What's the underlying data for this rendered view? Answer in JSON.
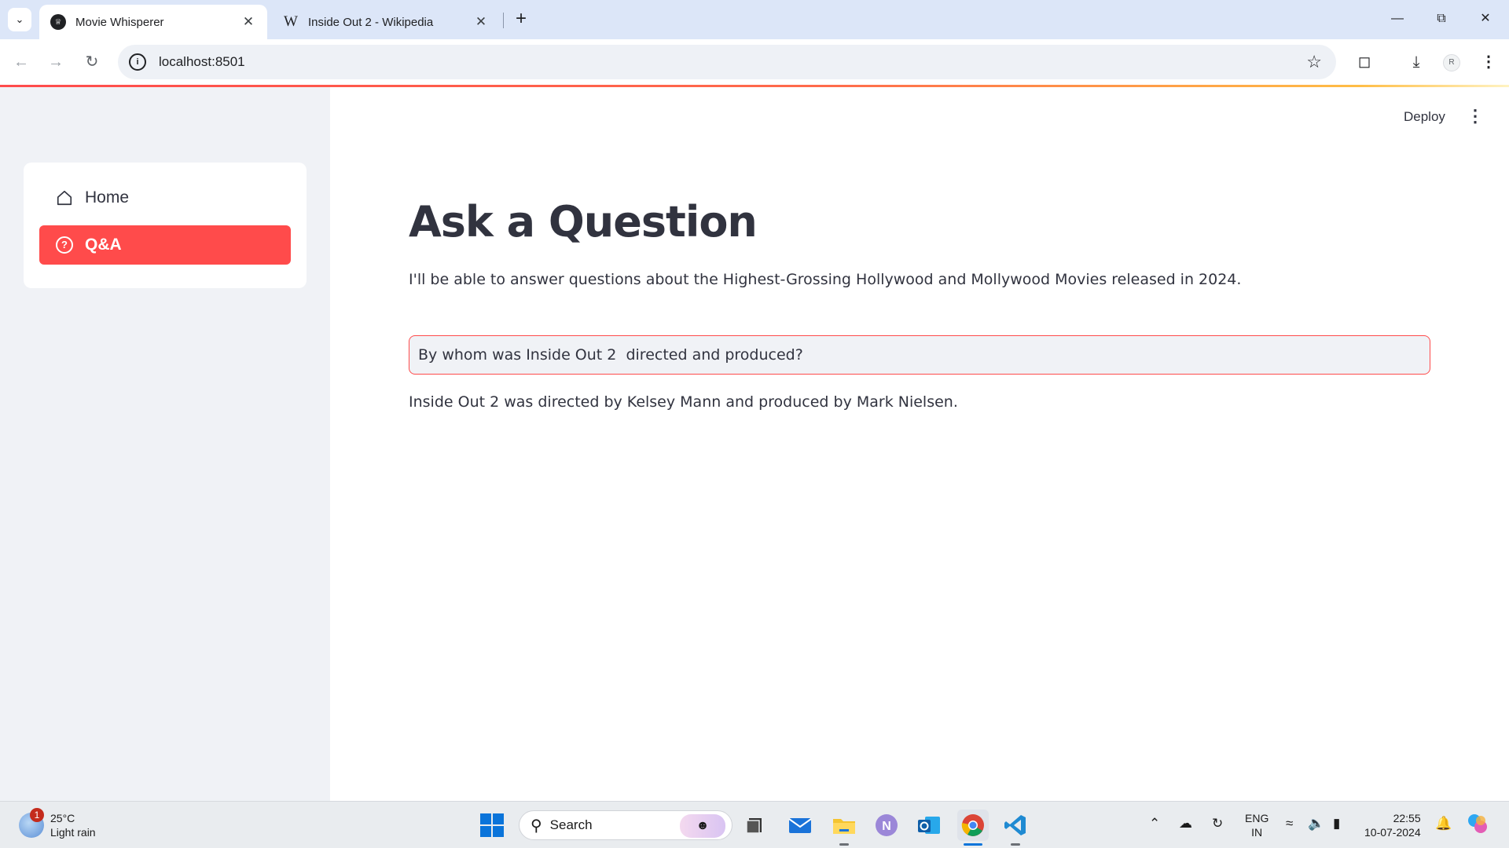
{
  "browser": {
    "tabs": [
      {
        "title": "Movie Whisperer",
        "active": true,
        "favicon": "crown-icon"
      },
      {
        "title": "Inside Out 2 - Wikipedia",
        "active": false,
        "favicon": "wikipedia-w-icon"
      }
    ],
    "url": "localhost:8501"
  },
  "app": {
    "header": {
      "deploy_label": "Deploy"
    },
    "sidebar": {
      "items": [
        {
          "label": "Home",
          "icon": "house-icon",
          "active": false
        },
        {
          "label": "Q&A",
          "icon": "question-circle-icon",
          "active": true
        }
      ]
    },
    "main": {
      "title": "Ask a Question",
      "intro": "I'll be able to answer questions about the Highest-Grossing Hollywood and Mollywood Movies released in 2024.",
      "question_value": "By whom was Inside Out 2  directed and produced?",
      "answer": "Inside Out 2 was directed by Kelsey Mann and produced by Mark Nielsen."
    },
    "colors": {
      "accent": "#ff4b4b",
      "sidebar_bg": "#f0f2f6",
      "text": "#31333f"
    }
  },
  "taskbar": {
    "weather": {
      "temp": "25°C",
      "condition": "Light rain",
      "badge": "1"
    },
    "search_placeholder": "Search",
    "language": {
      "line1": "ENG",
      "line2": "IN"
    },
    "clock": {
      "time": "22:55",
      "date": "10-07-2024"
    }
  }
}
